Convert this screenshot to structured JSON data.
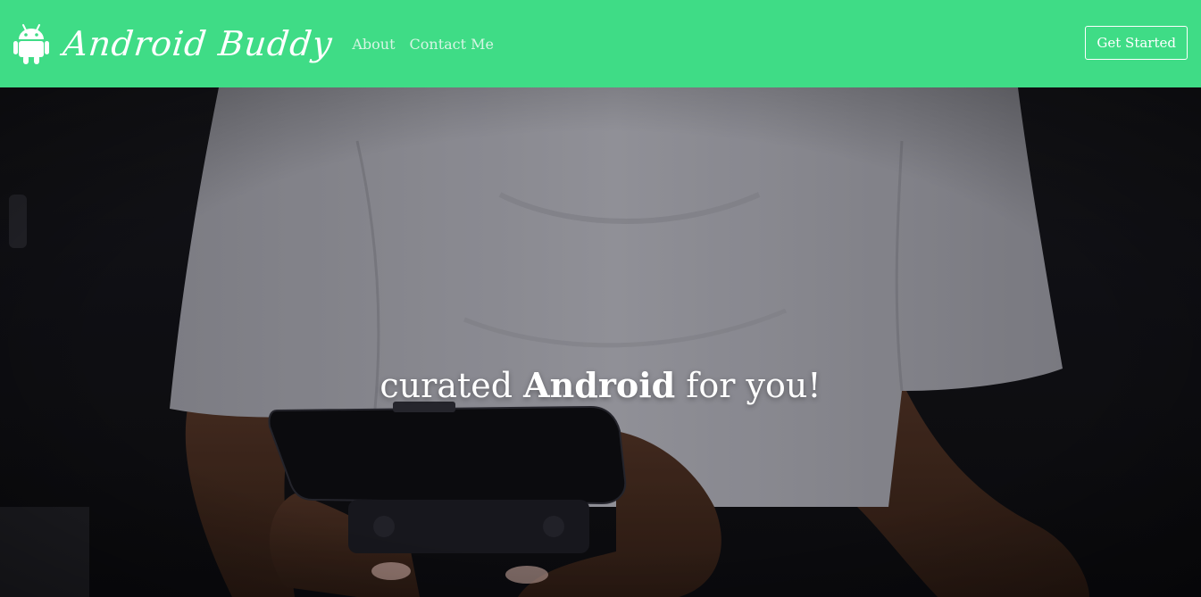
{
  "brand": {
    "name": "Android Buddy",
    "icon": "android-robot-icon"
  },
  "nav": {
    "links": [
      "About",
      "Contact Me"
    ],
    "cta_label": "Get Started"
  },
  "hero": {
    "headline_pre": "curated ",
    "headline_bold": "Android",
    "headline_post": " for you!",
    "image": "person-holding-phone-photo"
  },
  "colors": {
    "navbar": "#3fdc86",
    "text": "#ffffff",
    "nav_link": "#d7f5e4"
  }
}
